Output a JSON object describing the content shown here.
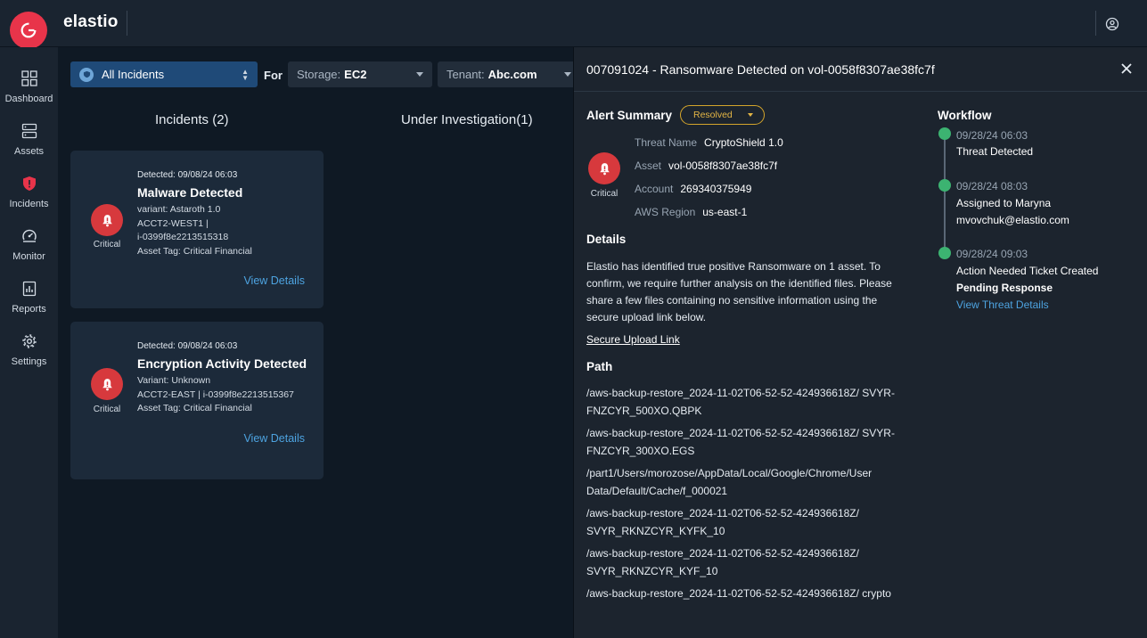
{
  "app": {
    "brand": "elastio"
  },
  "sidebar": {
    "items": [
      {
        "label": "Dashboard",
        "icon": "dashboard-icon"
      },
      {
        "label": "Assets",
        "icon": "server-icon"
      },
      {
        "label": "Incidents",
        "icon": "shield-alert-icon",
        "active": true
      },
      {
        "label": "Monitor",
        "icon": "monitor-icon"
      },
      {
        "label": "Reports",
        "icon": "report-icon"
      },
      {
        "label": "Settings",
        "icon": "gear-icon"
      }
    ]
  },
  "filters": {
    "incidents": "All Incidents",
    "for_label": "For",
    "storage_label": "Storage:",
    "storage_value": "EC2",
    "tenant_label": "Tenant:",
    "tenant_value": "Abc.com"
  },
  "columns": {
    "incidents": "Incidents (2)",
    "investigation": "Under Investigation(1)"
  },
  "cards": [
    {
      "detected": "Detected: 09/08/24 06:03",
      "title": "Malware Detected",
      "severity": "Critical",
      "meta": "variant: Astaroth 1.0\nACCT2-WEST1 |\ni-0399f8e2213515318\nAsset Tag: Critical Financial",
      "link": "View Details"
    },
    {
      "detected": "Detected: 09/08/24 06:03",
      "title": "Encryption Activity Detected",
      "severity": "Critical",
      "meta": "Variant: Unknown\nACCT2-EAST | i-0399f8e2213515367\nAsset Tag: Critical Financial",
      "link": "View Details"
    }
  ],
  "panel": {
    "title": "007091024 - Ransomware Detected on vol-0058f8307ae38fc7f",
    "alert_summary": "Alert Summary",
    "status": "Resolved",
    "severity": "Critical",
    "fields": [
      {
        "key": "Threat Name",
        "value": "CryptoShield 1.0"
      },
      {
        "key": "Asset",
        "value": "vol-0058f8307ae38fc7f"
      },
      {
        "key": "Account",
        "value": "269340375949"
      },
      {
        "key": "AWS Region",
        "value": "us-east-1"
      }
    ],
    "details_heading": "Details",
    "details_text": "Elastio has identified true positive  Ransomware on 1 asset. To confirm, we require further analysis on the identified files. Please share a few files containing no sensitive information using the secure upload link below.",
    "upload_link": "Secure Upload Link",
    "path_heading": "Path",
    "paths": [
      "/aws-backup-restore_2024-11-02T06-52-52-424936618Z/ SVYR-FNZCYR_500XO.QBPK",
      "/aws-backup-restore_2024-11-02T06-52-52-424936618Z/ SVYR-FNZCYR_300XO.EGS",
      "/part1/Users/morozose/AppData/Local/Google/Chrome/User Data/Default/Cache/f_000021",
      "/aws-backup-restore_2024-11-02T06-52-52-424936618Z/ SVYR_RKNZCYR_KYFK_10",
      "/aws-backup-restore_2024-11-02T06-52-52-424936618Z/ SVYR_RKNZCYR_KYF_10",
      "/aws-backup-restore_2024-11-02T06-52-52-424936618Z/ crypto"
    ],
    "workflow_heading": "Workflow",
    "workflow": [
      {
        "time": "09/28/24 06:03",
        "text": "Threat Detected"
      },
      {
        "time": "09/28/24 08:03",
        "text": "Assigned to Maryna mvovchuk@elastio.com"
      },
      {
        "time": "09/28/24 09:03",
        "text": "Action Needed Ticket Created",
        "bold": "Pending Response",
        "link": "View Threat Details"
      }
    ]
  },
  "colors": {
    "accent": "#e8344a",
    "critical": "#d7393d",
    "link": "#4da3e0",
    "resolved": "#d4a52b",
    "workflow_dot": "#3cb371"
  }
}
